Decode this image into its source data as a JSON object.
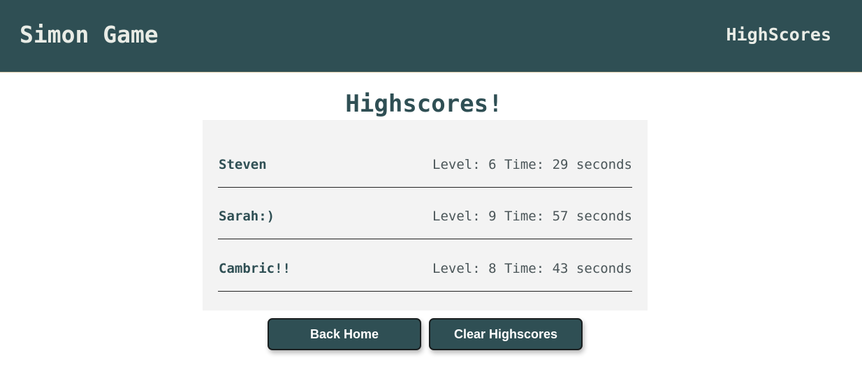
{
  "header": {
    "brand": "Simon Game",
    "nav_highscores": "HighScores"
  },
  "main": {
    "title": "Highscores!",
    "scores": [
      {
        "name": "Steven",
        "stats": "Level: 6 Time: 29 seconds"
      },
      {
        "name": "Sarah:)",
        "stats": "Level: 9 Time: 57 seconds"
      },
      {
        "name": "Cambric!!",
        "stats": "Level: 8 Time: 43 seconds"
      }
    ],
    "back_home_label": "Back Home",
    "clear_label": "Clear Highscores"
  },
  "colors": {
    "primary": "#2f4f54",
    "panel": "#f3f3f3",
    "header_text": "#e9ece6"
  }
}
